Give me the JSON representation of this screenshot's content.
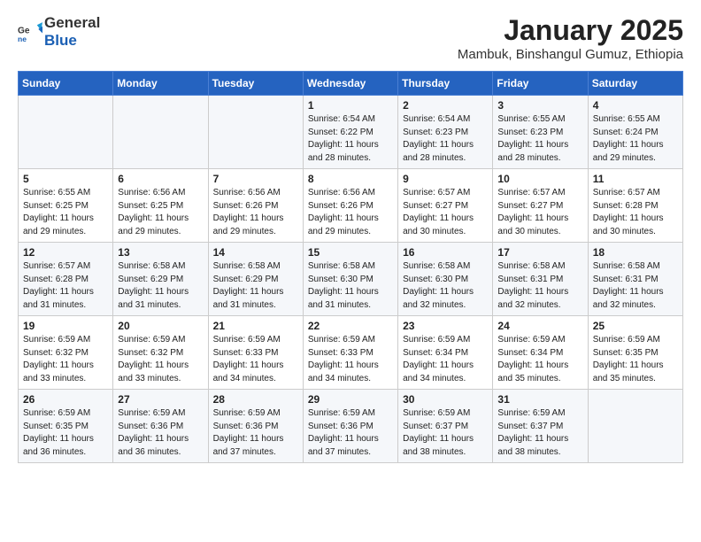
{
  "logo": {
    "general": "General",
    "blue": "Blue"
  },
  "header": {
    "title": "January 2025",
    "subtitle": "Mambuk, Binshangul Gumuz, Ethiopia"
  },
  "columns": [
    "Sunday",
    "Monday",
    "Tuesday",
    "Wednesday",
    "Thursday",
    "Friday",
    "Saturday"
  ],
  "weeks": [
    [
      {
        "day": "",
        "info": ""
      },
      {
        "day": "",
        "info": ""
      },
      {
        "day": "",
        "info": ""
      },
      {
        "day": "1",
        "info": "Sunrise: 6:54 AM\nSunset: 6:22 PM\nDaylight: 11 hours and 28 minutes."
      },
      {
        "day": "2",
        "info": "Sunrise: 6:54 AM\nSunset: 6:23 PM\nDaylight: 11 hours and 28 minutes."
      },
      {
        "day": "3",
        "info": "Sunrise: 6:55 AM\nSunset: 6:23 PM\nDaylight: 11 hours and 28 minutes."
      },
      {
        "day": "4",
        "info": "Sunrise: 6:55 AM\nSunset: 6:24 PM\nDaylight: 11 hours and 29 minutes."
      }
    ],
    [
      {
        "day": "5",
        "info": "Sunrise: 6:55 AM\nSunset: 6:25 PM\nDaylight: 11 hours and 29 minutes."
      },
      {
        "day": "6",
        "info": "Sunrise: 6:56 AM\nSunset: 6:25 PM\nDaylight: 11 hours and 29 minutes."
      },
      {
        "day": "7",
        "info": "Sunrise: 6:56 AM\nSunset: 6:26 PM\nDaylight: 11 hours and 29 minutes."
      },
      {
        "day": "8",
        "info": "Sunrise: 6:56 AM\nSunset: 6:26 PM\nDaylight: 11 hours and 29 minutes."
      },
      {
        "day": "9",
        "info": "Sunrise: 6:57 AM\nSunset: 6:27 PM\nDaylight: 11 hours and 30 minutes."
      },
      {
        "day": "10",
        "info": "Sunrise: 6:57 AM\nSunset: 6:27 PM\nDaylight: 11 hours and 30 minutes."
      },
      {
        "day": "11",
        "info": "Sunrise: 6:57 AM\nSunset: 6:28 PM\nDaylight: 11 hours and 30 minutes."
      }
    ],
    [
      {
        "day": "12",
        "info": "Sunrise: 6:57 AM\nSunset: 6:28 PM\nDaylight: 11 hours and 31 minutes."
      },
      {
        "day": "13",
        "info": "Sunrise: 6:58 AM\nSunset: 6:29 PM\nDaylight: 11 hours and 31 minutes."
      },
      {
        "day": "14",
        "info": "Sunrise: 6:58 AM\nSunset: 6:29 PM\nDaylight: 11 hours and 31 minutes."
      },
      {
        "day": "15",
        "info": "Sunrise: 6:58 AM\nSunset: 6:30 PM\nDaylight: 11 hours and 31 minutes."
      },
      {
        "day": "16",
        "info": "Sunrise: 6:58 AM\nSunset: 6:30 PM\nDaylight: 11 hours and 32 minutes."
      },
      {
        "day": "17",
        "info": "Sunrise: 6:58 AM\nSunset: 6:31 PM\nDaylight: 11 hours and 32 minutes."
      },
      {
        "day": "18",
        "info": "Sunrise: 6:58 AM\nSunset: 6:31 PM\nDaylight: 11 hours and 32 minutes."
      }
    ],
    [
      {
        "day": "19",
        "info": "Sunrise: 6:59 AM\nSunset: 6:32 PM\nDaylight: 11 hours and 33 minutes."
      },
      {
        "day": "20",
        "info": "Sunrise: 6:59 AM\nSunset: 6:32 PM\nDaylight: 11 hours and 33 minutes."
      },
      {
        "day": "21",
        "info": "Sunrise: 6:59 AM\nSunset: 6:33 PM\nDaylight: 11 hours and 34 minutes."
      },
      {
        "day": "22",
        "info": "Sunrise: 6:59 AM\nSunset: 6:33 PM\nDaylight: 11 hours and 34 minutes."
      },
      {
        "day": "23",
        "info": "Sunrise: 6:59 AM\nSunset: 6:34 PM\nDaylight: 11 hours and 34 minutes."
      },
      {
        "day": "24",
        "info": "Sunrise: 6:59 AM\nSunset: 6:34 PM\nDaylight: 11 hours and 35 minutes."
      },
      {
        "day": "25",
        "info": "Sunrise: 6:59 AM\nSunset: 6:35 PM\nDaylight: 11 hours and 35 minutes."
      }
    ],
    [
      {
        "day": "26",
        "info": "Sunrise: 6:59 AM\nSunset: 6:35 PM\nDaylight: 11 hours and 36 minutes."
      },
      {
        "day": "27",
        "info": "Sunrise: 6:59 AM\nSunset: 6:36 PM\nDaylight: 11 hours and 36 minutes."
      },
      {
        "day": "28",
        "info": "Sunrise: 6:59 AM\nSunset: 6:36 PM\nDaylight: 11 hours and 37 minutes."
      },
      {
        "day": "29",
        "info": "Sunrise: 6:59 AM\nSunset: 6:36 PM\nDaylight: 11 hours and 37 minutes."
      },
      {
        "day": "30",
        "info": "Sunrise: 6:59 AM\nSunset: 6:37 PM\nDaylight: 11 hours and 38 minutes."
      },
      {
        "day": "31",
        "info": "Sunrise: 6:59 AM\nSunset: 6:37 PM\nDaylight: 11 hours and 38 minutes."
      },
      {
        "day": "",
        "info": ""
      }
    ]
  ]
}
